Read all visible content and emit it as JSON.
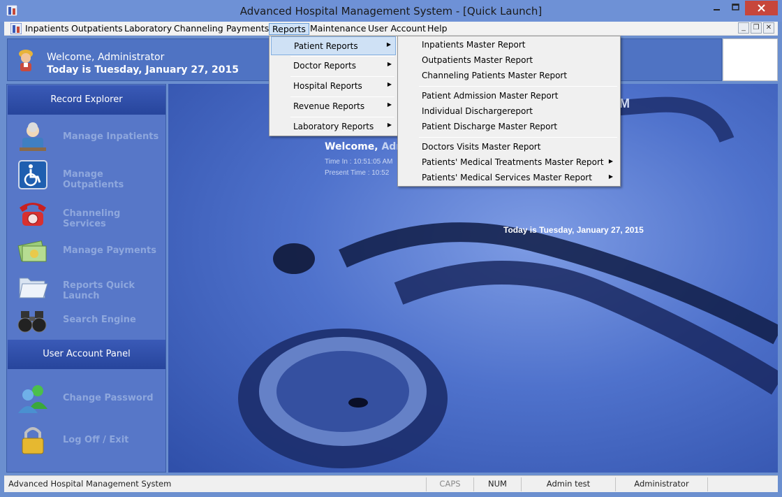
{
  "window": {
    "title": "Advanced Hospital Management System - [Quick Launch]"
  },
  "menubar": {
    "items": [
      "Inpatients",
      "Outpatients",
      "Laboratory",
      "Channeling",
      "Payments",
      "Reports",
      "Maintenance",
      "User Account",
      "Help"
    ],
    "active": "Reports"
  },
  "banner": {
    "welcome": "Welcome, Administrator",
    "today": "Today is Tuesday, January 27, 2015"
  },
  "sidebar": {
    "record_explorer": {
      "title": "Record Explorer",
      "items": [
        "Manage Inpatients",
        "Manage Outpatients",
        "Channeling Services",
        "Manage Payments",
        "Reports Quick Launch",
        "Search Engine"
      ]
    },
    "user_account_panel": {
      "title": "User Account Panel",
      "items": [
        "Change Password",
        "Log Off / Exit"
      ]
    }
  },
  "main": {
    "partial_title_letter": "M",
    "welcome_label": "Welcome,",
    "welcome_name": "Admi",
    "time_in": "Time In :  10:51:05 AM",
    "present_time": "Present Time :  10:52",
    "today": "Today is Tuesday, January 27, 2015"
  },
  "reports_menu": {
    "items": [
      "Patient Reports",
      "Doctor Reports",
      "Hospital Reports",
      "Revenue Reports",
      "Laboratory Reports"
    ],
    "highlighted": "Patient Reports"
  },
  "patient_reports_menu": {
    "groups": [
      [
        "Inpatients Master Report",
        "Outpatients Master Report",
        "Channeling Patients Master Report"
      ],
      [
        "Patient Admission Master Report",
        "Individual Dischargereport",
        "Patient Discharge Master Report"
      ],
      [
        "Doctors Visits Master Report",
        "Patients' Medical Treatments Master Report",
        "Patients' Medical Services Master Report"
      ]
    ]
  },
  "statusbar": {
    "app": "Advanced Hospital Management System",
    "caps": "CAPS",
    "num": "NUM",
    "user": "Admin test",
    "role": "Administrator"
  },
  "colors": {
    "titlebar": "#6e91d6",
    "banner": "#4f73c3",
    "sidebar": "#5777c8",
    "section_header": "#27459c",
    "close_button": "#c7463b"
  },
  "icons": [
    "hospital-app-icon",
    "user-avatar-icon",
    "inpatient-icon",
    "wheelchair-icon",
    "telephone-icon",
    "money-icon",
    "folder-icon",
    "binoculars-icon",
    "users-icon",
    "padlock-icon",
    "submenu-arrow-icon"
  ]
}
